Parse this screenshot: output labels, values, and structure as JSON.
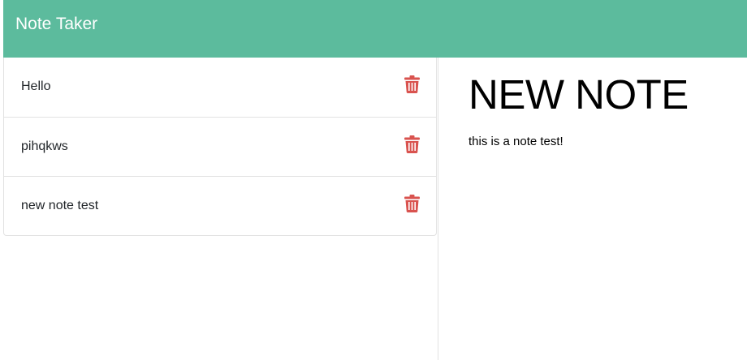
{
  "header": {
    "brand": "Note Taker",
    "background_color": "#5cbb9d"
  },
  "notes": [
    {
      "title": "Hello",
      "delete_icon": "trash-icon"
    },
    {
      "title": "pihqkws",
      "delete_icon": "trash-icon"
    },
    {
      "title": "new note test",
      "delete_icon": "trash-icon"
    }
  ],
  "editor": {
    "title": "NEW NOTE",
    "text": "this is a note test!"
  },
  "colors": {
    "delete_icon": "#d9534f",
    "border": "#e2e2e2"
  }
}
